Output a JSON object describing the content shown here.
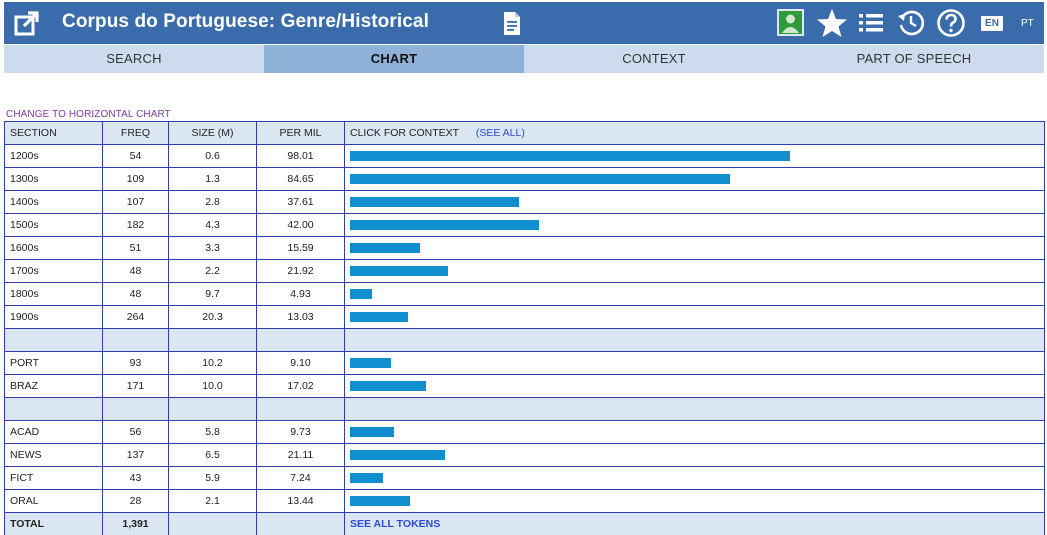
{
  "header": {
    "title": "Corpus do Portuguese: Genre/Historical",
    "lang_en": "EN",
    "lang_pt": "PT"
  },
  "tabs": [
    {
      "label": "SEARCH",
      "active": false
    },
    {
      "label": "CHART",
      "active": true
    },
    {
      "label": "CONTEXT",
      "active": false
    },
    {
      "label": "PART OF SPEECH",
      "active": false
    }
  ],
  "change_link": "CHANGE TO HORIZONTAL CHART",
  "table": {
    "headers": {
      "section": "SECTION",
      "freq": "FREQ",
      "size": "SIZE (M)",
      "per_mil": "PER MIL",
      "context": "CLICK FOR CONTEXT",
      "see_all": "(SEE ALL)"
    },
    "rows": [
      {
        "section": "1200s",
        "freq": "54",
        "size": "0.6",
        "per_mil": "98.01",
        "bar": 98.01
      },
      {
        "section": "1300s",
        "freq": "109",
        "size": "1.3",
        "per_mil": "84.65",
        "bar": 84.65
      },
      {
        "section": "1400s",
        "freq": "107",
        "size": "2.8",
        "per_mil": "37.61",
        "bar": 37.61
      },
      {
        "section": "1500s",
        "freq": "182",
        "size": "4.3",
        "per_mil": "42.00",
        "bar": 42.0
      },
      {
        "section": "1600s",
        "freq": "51",
        "size": "3.3",
        "per_mil": "15.59",
        "bar": 15.59
      },
      {
        "section": "1700s",
        "freq": "48",
        "size": "2.2",
        "per_mil": "21.92",
        "bar": 21.92
      },
      {
        "section": "1800s",
        "freq": "48",
        "size": "9.7",
        "per_mil": "4.93",
        "bar": 4.93
      },
      {
        "section": "1900s",
        "freq": "264",
        "size": "20.3",
        "per_mil": "13.03",
        "bar": 13.03
      },
      {
        "separator": true
      },
      {
        "section": "PORT",
        "freq": "93",
        "size": "10.2",
        "per_mil": "9.10",
        "bar": 9.1
      },
      {
        "section": "BRAZ",
        "freq": "171",
        "size": "10.0",
        "per_mil": "17.02",
        "bar": 17.02
      },
      {
        "separator": true
      },
      {
        "section": "ACAD",
        "freq": "56",
        "size": "5.8",
        "per_mil": "9.73",
        "bar": 9.73
      },
      {
        "section": "NEWS",
        "freq": "137",
        "size": "6.5",
        "per_mil": "21.11",
        "bar": 21.11
      },
      {
        "section": "FICT",
        "freq": "43",
        "size": "5.9",
        "per_mil": "7.24",
        "bar": 7.24
      },
      {
        "section": "ORAL",
        "freq": "28",
        "size": "2.1",
        "per_mil": "13.44",
        "bar": 13.44
      }
    ],
    "total": {
      "label": "TOTAL",
      "freq": "1,391",
      "see_all_tokens": "SEE ALL TOKENS"
    },
    "bar_scale_max": 98.01
  },
  "colors": {
    "header_bg": "#3a6cab",
    "tab_bg": "#ccdcee",
    "tab_active_bg": "#8fb0d7",
    "bar": "#0f8fd0",
    "border": "#2f3fb0",
    "link": "#2a4bd0",
    "change_link": "#7b3c9e"
  },
  "icons": [
    "external-link-icon",
    "document-icon",
    "user-icon",
    "star-icon",
    "list-icon",
    "history-icon",
    "help-icon"
  ]
}
